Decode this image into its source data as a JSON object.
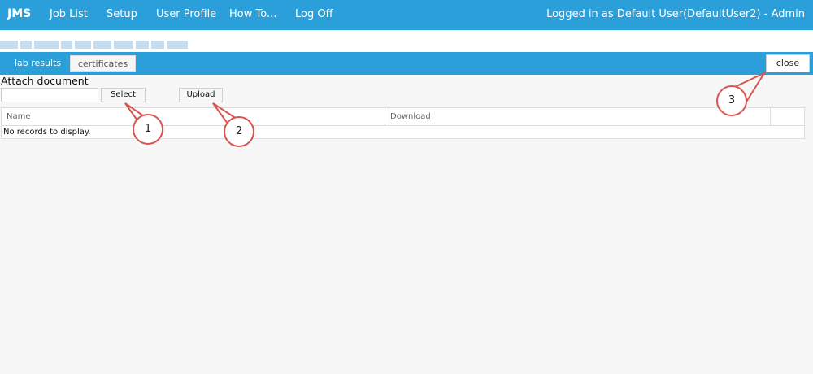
{
  "app": {
    "brand": "JMS",
    "nav": [
      "Job List",
      "Setup",
      "User Profile",
      "How To...",
      "Log Off"
    ],
    "login_info": "Logged in as Default User(DefaultUser2) - Admin"
  },
  "tabs": {
    "active": "lab results",
    "inactive": "certificates",
    "close_label": "close"
  },
  "attach": {
    "title": "Attach document",
    "select_label": "Select",
    "upload_label": "Upload"
  },
  "grid": {
    "columns": [
      "Name",
      "Download"
    ],
    "empty_text": "No records to display."
  },
  "callouts": [
    "1",
    "2",
    "3"
  ],
  "colors": {
    "header_bg": "#2a9fd9",
    "callout_border": "#d9534f"
  }
}
